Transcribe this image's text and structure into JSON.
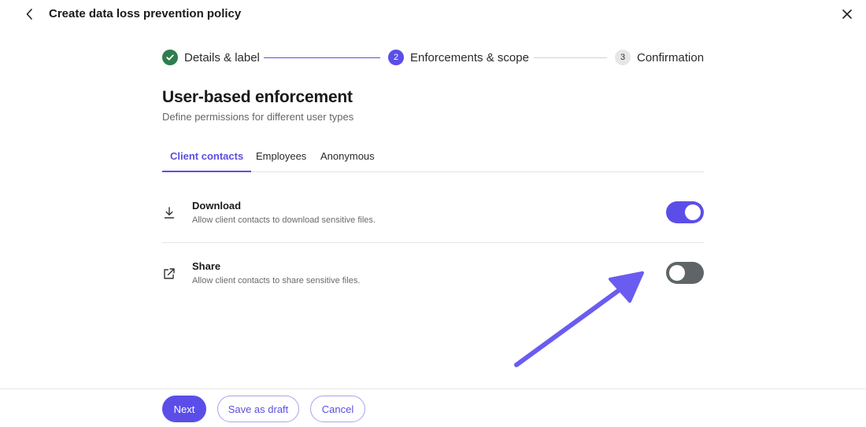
{
  "header": {
    "title": "Create data loss prevention policy",
    "back_icon": "chevron-left-icon",
    "close_icon": "close-icon"
  },
  "stepper": {
    "steps": [
      {
        "label": "Details & label",
        "number": "1",
        "status": "completed"
      },
      {
        "label": "Enforcements & scope",
        "number": "2",
        "status": "current"
      },
      {
        "label": "Confirmation",
        "number": "3",
        "status": "upcoming"
      }
    ]
  },
  "section": {
    "title": "User-based enforcement",
    "subtitle": "Define permissions for different user types"
  },
  "tabs": {
    "items": [
      {
        "label": "Client contacts",
        "active": true
      },
      {
        "label": "Employees",
        "active": false
      },
      {
        "label": "Anonymous",
        "active": false
      }
    ]
  },
  "permissions": [
    {
      "title": "Download",
      "description": "Allow client contacts to download sensitive files.",
      "icon": "download-icon",
      "enabled": true
    },
    {
      "title": "Share",
      "description": "Allow client contacts to share sensitive files.",
      "icon": "share-icon",
      "enabled": false
    }
  ],
  "footer": {
    "next_label": "Next",
    "save_draft_label": "Save as draft",
    "cancel_label": "Cancel"
  },
  "colors": {
    "accent": "#5b4ee8",
    "completed": "#2e7d4f",
    "toggle_off": "#5f6566",
    "annotation": "#6a5cf0"
  }
}
